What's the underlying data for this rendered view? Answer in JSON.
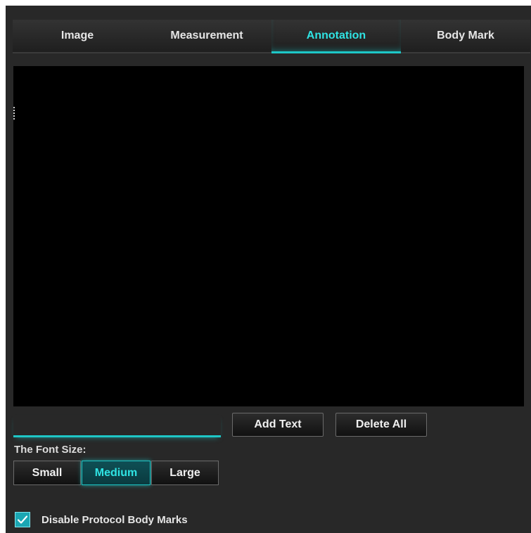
{
  "tabs": [
    {
      "label": "Image",
      "active": false
    },
    {
      "label": "Measurement",
      "active": false
    },
    {
      "label": "Annotation",
      "active": true
    },
    {
      "label": "Body Mark",
      "active": false
    }
  ],
  "annotation": {
    "text_input_value": "",
    "add_text_label": "Add Text",
    "delete_all_label": "Delete All"
  },
  "font_size": {
    "label": "The Font Size:",
    "options": [
      "Small",
      "Medium",
      "Large"
    ],
    "selected": "Medium"
  },
  "protocol": {
    "disable_body_marks_label": "Disable Protocol Body Marks",
    "checked": true
  },
  "colors": {
    "accent": "#1ec7c7",
    "background": "#282828",
    "canvas": "#000000"
  },
  "icons": {
    "checkbox": "checkmark-icon"
  }
}
